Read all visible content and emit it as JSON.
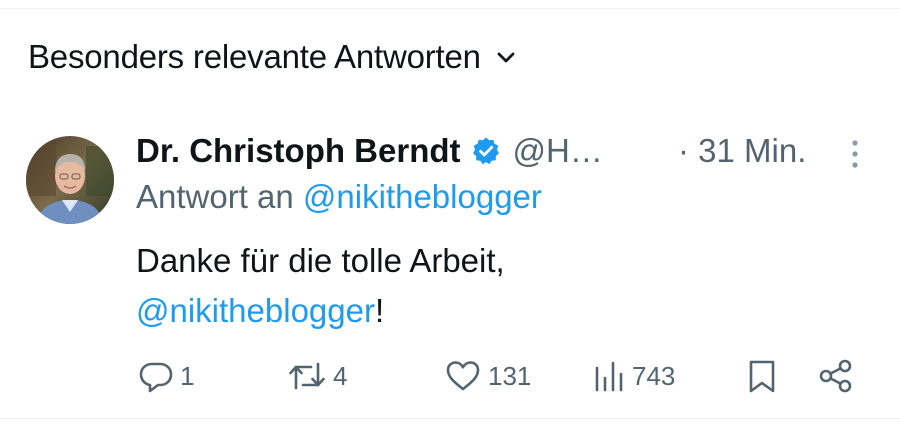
{
  "sort": {
    "label": "Besonders relevante Antworten",
    "chevron_icon": "chevron-down-icon"
  },
  "tweet": {
    "avatar_icon": "avatar-photo",
    "author_name": "Dr. Christoph Berndt",
    "verified_icon": "verified-badge-icon",
    "verified_color": "#1d9bf0",
    "handle": "@H…",
    "timestamp": "· 31 Min.",
    "more_icon": "more-vertical-icon",
    "reply_prefix": "Antwort an",
    "reply_to": "@nikitheblogger",
    "text_line1": "Danke für die tolle Arbeit,",
    "text_mention": "@nikitheblogger",
    "text_suffix": "!",
    "mention_color": "#1d9bf0"
  },
  "actions": {
    "reply": {
      "icon": "reply-icon",
      "count": "1"
    },
    "repost": {
      "icon": "repost-icon",
      "count": "4"
    },
    "like": {
      "icon": "heart-icon",
      "count": "131"
    },
    "views": {
      "icon": "views-chart-icon",
      "count": "743"
    },
    "bookmark": {
      "icon": "bookmark-icon"
    },
    "share": {
      "icon": "share-icon"
    }
  }
}
